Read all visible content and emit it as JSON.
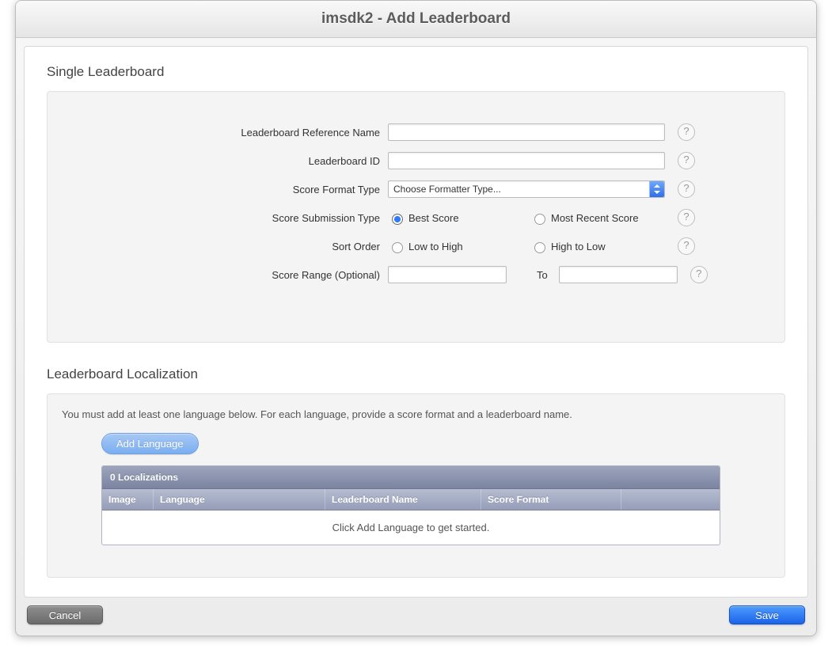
{
  "window": {
    "title": "imsdk2 - Add Leaderboard"
  },
  "section_single": {
    "title": "Single Leaderboard",
    "fields": {
      "ref_name": {
        "label": "Leaderboard Reference Name",
        "value": ""
      },
      "lb_id": {
        "label": "Leaderboard ID",
        "value": ""
      },
      "format": {
        "label": "Score Format Type",
        "selected": "Choose Formatter Type..."
      },
      "submission": {
        "label": "Score Submission Type",
        "options": {
          "best": "Best Score",
          "recent": "Most Recent Score"
        },
        "selected": "best"
      },
      "sort": {
        "label": "Sort Order",
        "options": {
          "low": "Low to High",
          "high": "High to Low"
        },
        "selected": ""
      },
      "range": {
        "label": "Score Range (Optional)",
        "from": "",
        "to_label": "To",
        "to": ""
      }
    }
  },
  "section_loc": {
    "title": "Leaderboard Localization",
    "hint": "You must add at least one language below. For each language, provide a score format and a leaderboard name.",
    "add_button": "Add Language",
    "table": {
      "header_count": "0 Localizations",
      "columns": {
        "image": "Image",
        "language": "Language",
        "name": "Leaderboard Name",
        "score": "Score Format"
      },
      "empty_text": "Click Add Language to get started."
    }
  },
  "footer": {
    "cancel": "Cancel",
    "save": "Save"
  }
}
